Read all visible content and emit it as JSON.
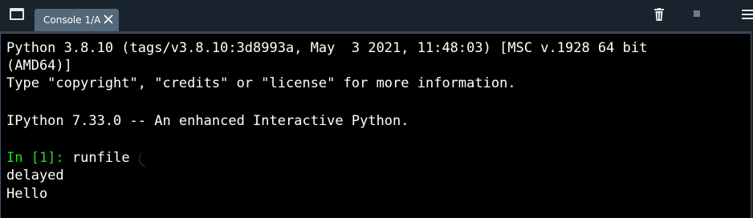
{
  "tabbar": {
    "icons": {
      "window": "window-icon",
      "close": "close-icon",
      "trash": "trash-icon",
      "stop": "stop-icon",
      "menu": "hamburger-menu-icon"
    },
    "tabs": [
      {
        "label": "Console 1/A"
      }
    ]
  },
  "console": {
    "lines": [
      "Python 3.8.10 (tags/v3.8.10:3d8993a, May  3 2021, 11:48:03) [MSC v.1928 64 bit",
      "(AMD64)]",
      "Type \"copyright\", \"credits\" or \"license\" for more information.",
      "",
      "IPython 7.33.0 -- An enhanced Interactive Python.",
      ""
    ],
    "input": {
      "prompt": "In [1]:",
      "command": "runfile"
    },
    "output": [
      "delayed",
      "Hello"
    ]
  },
  "colors": {
    "background": "#19232d",
    "tab_active": "#54687a",
    "console_bg": "#000000",
    "prompt": "#2ed42e",
    "text": "#ffffff"
  }
}
